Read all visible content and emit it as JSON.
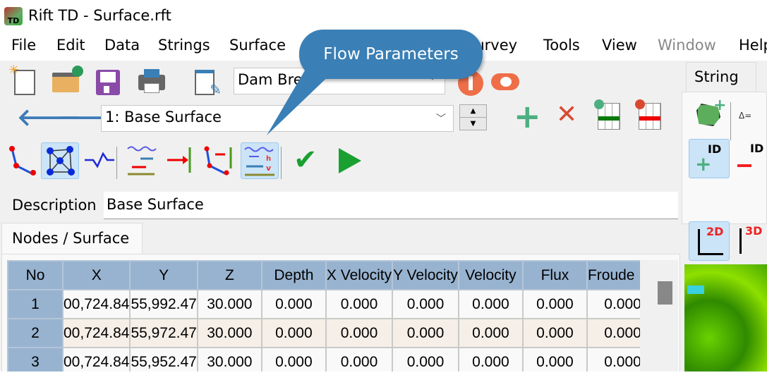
{
  "window": {
    "title": "Rift TD - Surface.rft",
    "app_icon_text": "TD"
  },
  "menu": [
    {
      "label": "File",
      "enabled": true
    },
    {
      "label": "Edit",
      "enabled": true
    },
    {
      "label": "Data",
      "enabled": true
    },
    {
      "label": "Strings",
      "enabled": true
    },
    {
      "label": "Surface",
      "enabled": true
    },
    {
      "label": "Survey",
      "enabled": true
    },
    {
      "label": "Tools",
      "enabled": true
    },
    {
      "label": "View",
      "enabled": true
    },
    {
      "label": "Window",
      "enabled": false
    },
    {
      "label": "Help",
      "enabled": true
    }
  ],
  "toolbar": {
    "project_combo": "Dam Break",
    "surface_combo": "1: Base Surface"
  },
  "callout": {
    "text": "Flow Parameters",
    "color": "#3a7fb5"
  },
  "description": {
    "label": "Description",
    "value": "Base Surface"
  },
  "tabs": [
    {
      "label": "Nodes / Surface",
      "active": true
    }
  ],
  "table": {
    "headers": [
      "No",
      "X",
      "Y",
      "Z",
      "Depth",
      "X Velocity",
      "Y Velocity",
      "Velocity",
      "Flux",
      "Froude No"
    ],
    "rows": [
      [
        "1",
        "00,724.84",
        "55,992.47",
        "30.000",
        "0.000",
        "0.000",
        "0.000",
        "0.000",
        "0.000",
        "0.000"
      ],
      [
        "2",
        "00,724.84",
        "55,972.47",
        "30.000",
        "0.000",
        "0.000",
        "0.000",
        "0.000",
        "0.000",
        "0.000"
      ],
      [
        "3",
        "00,724.84",
        "55,952.47",
        "30.000",
        "0.000",
        "0.000",
        "0.000",
        "0.000",
        "0.000",
        "0.000"
      ]
    ]
  },
  "right_panel": {
    "tab": "String",
    "view_2d": "2D",
    "view_3d": "3D",
    "id_label": "ID"
  },
  "colors": {
    "header_bg": "#98b3d0",
    "alt_row": "#f5efe7",
    "selected_tool": "#cce4f7"
  }
}
